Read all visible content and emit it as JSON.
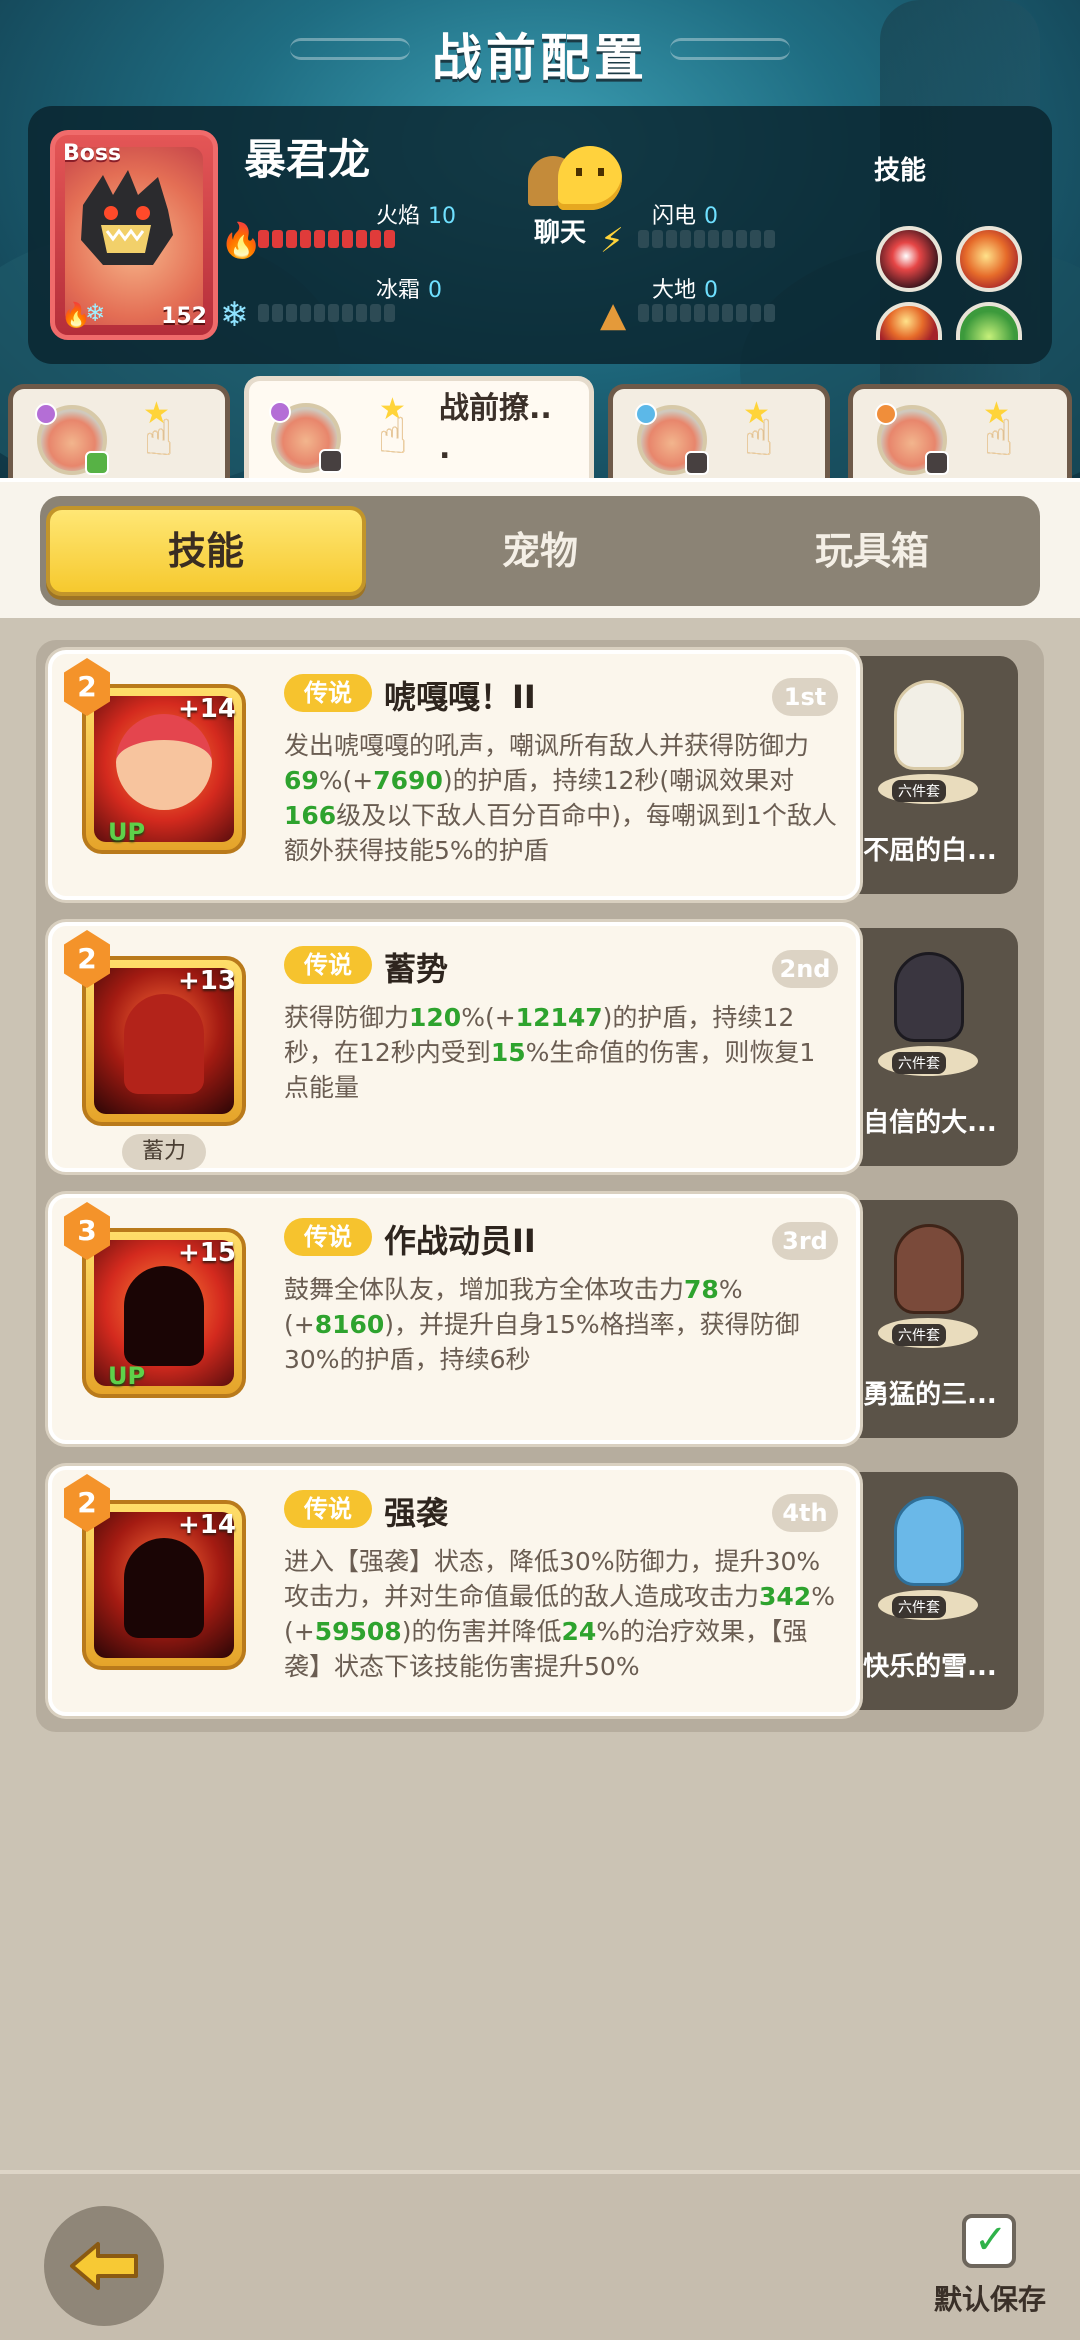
{
  "header": {
    "title": "战前配置",
    "boss": {
      "tag": "Boss",
      "name": "暴君龙",
      "level": "152"
    },
    "stats": [
      {
        "label": "火焰",
        "value": "10",
        "fill": 10,
        "max": 10
      },
      {
        "label": "闪电",
        "value": "0",
        "fill": 0,
        "max": 10
      },
      {
        "label": "冰霜",
        "value": "0",
        "fill": 0,
        "max": 10
      },
      {
        "label": "大地",
        "value": "0",
        "fill": 0,
        "max": 10
      }
    ],
    "chat_label": "聊天",
    "skills_label": "技能"
  },
  "slot_tabs": [
    {
      "label": "",
      "active": false
    },
    {
      "label": "战前撩..\n.",
      "active": true
    },
    {
      "label": "",
      "active": false
    },
    {
      "label": "",
      "active": false
    }
  ],
  "segments": [
    "技能",
    "宠物",
    "玩具箱"
  ],
  "active_segment": 0,
  "cards": [
    {
      "level": "2",
      "plus": "+14",
      "up": "UP",
      "sub_tag": "",
      "rarity": "传说",
      "name": "唬嘎嘎！II",
      "rank": "1st",
      "desc_parts": [
        [
          "发出唬嘎嘎的吼声，嘲讽所有敌人并获得防御力",
          false
        ],
        [
          "69",
          true
        ],
        [
          "%(+",
          false
        ],
        [
          "7690",
          true
        ],
        [
          ")的护盾，持续12秒(嘲讽效果对",
          false
        ],
        [
          "166",
          true
        ],
        [
          "级及以下敌人百分百命中)，每嘲讽到1个敌人额外获得技能5%的护盾",
          false
        ]
      ],
      "pet_label": "六件套",
      "pet_name": "不屈的白..."
    },
    {
      "level": "2",
      "plus": "+13",
      "up": "",
      "sub_tag": "蓄力",
      "rarity": "传说",
      "name": "蓄势",
      "rank": "2nd",
      "desc_parts": [
        [
          "获得防御力",
          false
        ],
        [
          "120",
          true
        ],
        [
          "%(+",
          false
        ],
        [
          "12147",
          true
        ],
        [
          ")的护盾，持续12秒，在12秒内受到",
          false
        ],
        [
          "15",
          true
        ],
        [
          "%生命值的伤害，则恢复1点能量",
          false
        ]
      ],
      "pet_label": "六件套",
      "pet_name": "自信的大..."
    },
    {
      "level": "3",
      "plus": "+15",
      "up": "UP",
      "sub_tag": "",
      "rarity": "传说",
      "name": "作战动员II",
      "rank": "3rd",
      "desc_parts": [
        [
          "鼓舞全体队友，增加我方全体攻击力",
          false
        ],
        [
          "78",
          true
        ],
        [
          "%(+",
          false
        ],
        [
          "8160",
          true
        ],
        [
          ")，并提升自身15%格挡率，获得防御30%的护盾，持续6秒",
          false
        ]
      ],
      "pet_label": "六件套",
      "pet_name": "勇猛的三..."
    },
    {
      "level": "2",
      "plus": "+14",
      "up": "",
      "sub_tag": "",
      "rarity": "传说",
      "name": "强袭",
      "rank": "4th",
      "desc_parts": [
        [
          "进入【强袭】状态，降低30%防御力，提升30%攻击力，并对生命值最低的敌人造成攻击力",
          false
        ],
        [
          "342",
          true
        ],
        [
          "%(+",
          false
        ],
        [
          "59508",
          true
        ],
        [
          ")的伤害并降低",
          false
        ],
        [
          "24",
          true
        ],
        [
          "%的治疗效果，【强袭】状态下该技能伤害提升50%",
          false
        ]
      ],
      "pet_label": "六件套",
      "pet_name": "快乐的雪..."
    }
  ],
  "footer": {
    "save_label": "默认保存"
  },
  "colors": {
    "accent_yellow": "#f6c32e",
    "highlight_green": "#2ea32e",
    "fire_red": "#e03b3a"
  }
}
